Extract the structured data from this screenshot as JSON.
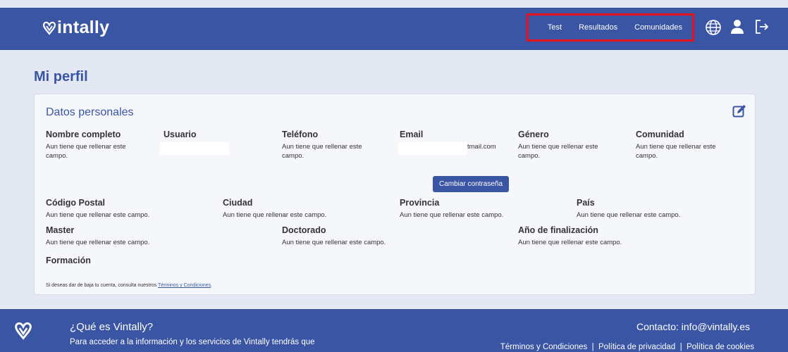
{
  "header": {
    "logo_text": "intally",
    "nav": [
      "Test",
      "Resultados",
      "Comunidades"
    ],
    "icons": [
      "globe-icon",
      "user-icon",
      "logout-icon"
    ],
    "highlight_color": "#e8101b"
  },
  "page": {
    "title": "Mi perfil"
  },
  "card": {
    "title": "Datos personales",
    "fields": {
      "nombre": {
        "label": "Nombre completo",
        "value": "Aun tiene que rellenar este campo."
      },
      "usuario": {
        "label": "Usuario",
        "value": ""
      },
      "telefono": {
        "label": "Teléfono",
        "value": "Aun tiene que rellenar este campo."
      },
      "email": {
        "label": "Email",
        "value": "tmail.com"
      },
      "genero": {
        "label": "Género",
        "value": "Aun tiene que rellenar este campo."
      },
      "comunidad": {
        "label": "Comunidad",
        "value": "Aun tiene que rellenar este campo."
      },
      "codigo_postal": {
        "label": "Código Postal",
        "value": "Aun tiene que rellenar este campo."
      },
      "ciudad": {
        "label": "Ciudad",
        "value": "Aun tiene que rellenar este campo."
      },
      "provincia": {
        "label": "Provincia",
        "value": "Aun tiene que rellenar este campo."
      },
      "pais": {
        "label": "País",
        "value": "Aun tiene que rellenar este campo."
      },
      "master": {
        "label": "Master",
        "value": "Aun tiene que rellenar este campo."
      },
      "doctorado": {
        "label": "Doctorado",
        "value": "Aun tiene que rellenar este campo."
      },
      "anio_finalizacion": {
        "label": "Año de finalización",
        "value": "Aun tiene que rellenar este campo."
      },
      "formacion": {
        "label": "Formación",
        "value": ""
      }
    },
    "change_password_label": "Cambiar contraseña",
    "terms_prefix": "Si deseas dar de baja tu cuenta, consulta nuestros ",
    "terms_link": "Términos y Condiciones",
    "terms_suffix": "."
  },
  "footer": {
    "heading": "¿Qué es Vintally?",
    "description": "Para acceder a la información y los servicios de Vintally tendrás que",
    "contact": "Contacto: info@vintally.es",
    "links": [
      "Términos y Condiciones",
      "Política de privacidad",
      "Política de cookies"
    ]
  }
}
